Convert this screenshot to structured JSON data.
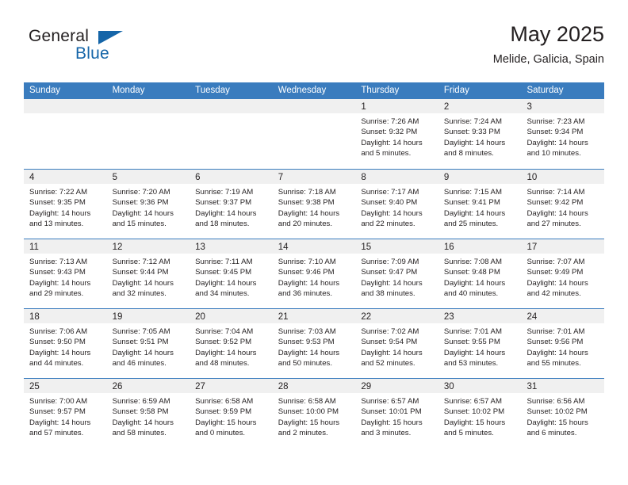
{
  "brand": {
    "name_part1": "General",
    "name_part2": "Blue"
  },
  "header": {
    "month_title": "May 2025",
    "location": "Melide, Galicia, Spain"
  },
  "colors": {
    "header_blue": "#3a7cbe",
    "brand_blue": "#1565a8",
    "day_band_gray": "#f0f0f0",
    "text": "#231f20"
  },
  "weekdays": [
    "Sunday",
    "Monday",
    "Tuesday",
    "Wednesday",
    "Thursday",
    "Friday",
    "Saturday"
  ],
  "weeks": [
    [
      {
        "day": "",
        "empty": true,
        "sunrise": "",
        "sunset": "",
        "daylight1": "",
        "daylight2": ""
      },
      {
        "day": "",
        "empty": true,
        "sunrise": "",
        "sunset": "",
        "daylight1": "",
        "daylight2": ""
      },
      {
        "day": "",
        "empty": true,
        "sunrise": "",
        "sunset": "",
        "daylight1": "",
        "daylight2": ""
      },
      {
        "day": "",
        "empty": true,
        "sunrise": "",
        "sunset": "",
        "daylight1": "",
        "daylight2": ""
      },
      {
        "day": "1",
        "empty": false,
        "sunrise": "Sunrise: 7:26 AM",
        "sunset": "Sunset: 9:32 PM",
        "daylight1": "Daylight: 14 hours",
        "daylight2": "and 5 minutes."
      },
      {
        "day": "2",
        "empty": false,
        "sunrise": "Sunrise: 7:24 AM",
        "sunset": "Sunset: 9:33 PM",
        "daylight1": "Daylight: 14 hours",
        "daylight2": "and 8 minutes."
      },
      {
        "day": "3",
        "empty": false,
        "sunrise": "Sunrise: 7:23 AM",
        "sunset": "Sunset: 9:34 PM",
        "daylight1": "Daylight: 14 hours",
        "daylight2": "and 10 minutes."
      }
    ],
    [
      {
        "day": "4",
        "empty": false,
        "sunrise": "Sunrise: 7:22 AM",
        "sunset": "Sunset: 9:35 PM",
        "daylight1": "Daylight: 14 hours",
        "daylight2": "and 13 minutes."
      },
      {
        "day": "5",
        "empty": false,
        "sunrise": "Sunrise: 7:20 AM",
        "sunset": "Sunset: 9:36 PM",
        "daylight1": "Daylight: 14 hours",
        "daylight2": "and 15 minutes."
      },
      {
        "day": "6",
        "empty": false,
        "sunrise": "Sunrise: 7:19 AM",
        "sunset": "Sunset: 9:37 PM",
        "daylight1": "Daylight: 14 hours",
        "daylight2": "and 18 minutes."
      },
      {
        "day": "7",
        "empty": false,
        "sunrise": "Sunrise: 7:18 AM",
        "sunset": "Sunset: 9:38 PM",
        "daylight1": "Daylight: 14 hours",
        "daylight2": "and 20 minutes."
      },
      {
        "day": "8",
        "empty": false,
        "sunrise": "Sunrise: 7:17 AM",
        "sunset": "Sunset: 9:40 PM",
        "daylight1": "Daylight: 14 hours",
        "daylight2": "and 22 minutes."
      },
      {
        "day": "9",
        "empty": false,
        "sunrise": "Sunrise: 7:15 AM",
        "sunset": "Sunset: 9:41 PM",
        "daylight1": "Daylight: 14 hours",
        "daylight2": "and 25 minutes."
      },
      {
        "day": "10",
        "empty": false,
        "sunrise": "Sunrise: 7:14 AM",
        "sunset": "Sunset: 9:42 PM",
        "daylight1": "Daylight: 14 hours",
        "daylight2": "and 27 minutes."
      }
    ],
    [
      {
        "day": "11",
        "empty": false,
        "sunrise": "Sunrise: 7:13 AM",
        "sunset": "Sunset: 9:43 PM",
        "daylight1": "Daylight: 14 hours",
        "daylight2": "and 29 minutes."
      },
      {
        "day": "12",
        "empty": false,
        "sunrise": "Sunrise: 7:12 AM",
        "sunset": "Sunset: 9:44 PM",
        "daylight1": "Daylight: 14 hours",
        "daylight2": "and 32 minutes."
      },
      {
        "day": "13",
        "empty": false,
        "sunrise": "Sunrise: 7:11 AM",
        "sunset": "Sunset: 9:45 PM",
        "daylight1": "Daylight: 14 hours",
        "daylight2": "and 34 minutes."
      },
      {
        "day": "14",
        "empty": false,
        "sunrise": "Sunrise: 7:10 AM",
        "sunset": "Sunset: 9:46 PM",
        "daylight1": "Daylight: 14 hours",
        "daylight2": "and 36 minutes."
      },
      {
        "day": "15",
        "empty": false,
        "sunrise": "Sunrise: 7:09 AM",
        "sunset": "Sunset: 9:47 PM",
        "daylight1": "Daylight: 14 hours",
        "daylight2": "and 38 minutes."
      },
      {
        "day": "16",
        "empty": false,
        "sunrise": "Sunrise: 7:08 AM",
        "sunset": "Sunset: 9:48 PM",
        "daylight1": "Daylight: 14 hours",
        "daylight2": "and 40 minutes."
      },
      {
        "day": "17",
        "empty": false,
        "sunrise": "Sunrise: 7:07 AM",
        "sunset": "Sunset: 9:49 PM",
        "daylight1": "Daylight: 14 hours",
        "daylight2": "and 42 minutes."
      }
    ],
    [
      {
        "day": "18",
        "empty": false,
        "sunrise": "Sunrise: 7:06 AM",
        "sunset": "Sunset: 9:50 PM",
        "daylight1": "Daylight: 14 hours",
        "daylight2": "and 44 minutes."
      },
      {
        "day": "19",
        "empty": false,
        "sunrise": "Sunrise: 7:05 AM",
        "sunset": "Sunset: 9:51 PM",
        "daylight1": "Daylight: 14 hours",
        "daylight2": "and 46 minutes."
      },
      {
        "day": "20",
        "empty": false,
        "sunrise": "Sunrise: 7:04 AM",
        "sunset": "Sunset: 9:52 PM",
        "daylight1": "Daylight: 14 hours",
        "daylight2": "and 48 minutes."
      },
      {
        "day": "21",
        "empty": false,
        "sunrise": "Sunrise: 7:03 AM",
        "sunset": "Sunset: 9:53 PM",
        "daylight1": "Daylight: 14 hours",
        "daylight2": "and 50 minutes."
      },
      {
        "day": "22",
        "empty": false,
        "sunrise": "Sunrise: 7:02 AM",
        "sunset": "Sunset: 9:54 PM",
        "daylight1": "Daylight: 14 hours",
        "daylight2": "and 52 minutes."
      },
      {
        "day": "23",
        "empty": false,
        "sunrise": "Sunrise: 7:01 AM",
        "sunset": "Sunset: 9:55 PM",
        "daylight1": "Daylight: 14 hours",
        "daylight2": "and 53 minutes."
      },
      {
        "day": "24",
        "empty": false,
        "sunrise": "Sunrise: 7:01 AM",
        "sunset": "Sunset: 9:56 PM",
        "daylight1": "Daylight: 14 hours",
        "daylight2": "and 55 minutes."
      }
    ],
    [
      {
        "day": "25",
        "empty": false,
        "sunrise": "Sunrise: 7:00 AM",
        "sunset": "Sunset: 9:57 PM",
        "daylight1": "Daylight: 14 hours",
        "daylight2": "and 57 minutes."
      },
      {
        "day": "26",
        "empty": false,
        "sunrise": "Sunrise: 6:59 AM",
        "sunset": "Sunset: 9:58 PM",
        "daylight1": "Daylight: 14 hours",
        "daylight2": "and 58 minutes."
      },
      {
        "day": "27",
        "empty": false,
        "sunrise": "Sunrise: 6:58 AM",
        "sunset": "Sunset: 9:59 PM",
        "daylight1": "Daylight: 15 hours",
        "daylight2": "and 0 minutes."
      },
      {
        "day": "28",
        "empty": false,
        "sunrise": "Sunrise: 6:58 AM",
        "sunset": "Sunset: 10:00 PM",
        "daylight1": "Daylight: 15 hours",
        "daylight2": "and 2 minutes."
      },
      {
        "day": "29",
        "empty": false,
        "sunrise": "Sunrise: 6:57 AM",
        "sunset": "Sunset: 10:01 PM",
        "daylight1": "Daylight: 15 hours",
        "daylight2": "and 3 minutes."
      },
      {
        "day": "30",
        "empty": false,
        "sunrise": "Sunrise: 6:57 AM",
        "sunset": "Sunset: 10:02 PM",
        "daylight1": "Daylight: 15 hours",
        "daylight2": "and 5 minutes."
      },
      {
        "day": "31",
        "empty": false,
        "sunrise": "Sunrise: 6:56 AM",
        "sunset": "Sunset: 10:02 PM",
        "daylight1": "Daylight: 15 hours",
        "daylight2": "and 6 minutes."
      }
    ]
  ]
}
